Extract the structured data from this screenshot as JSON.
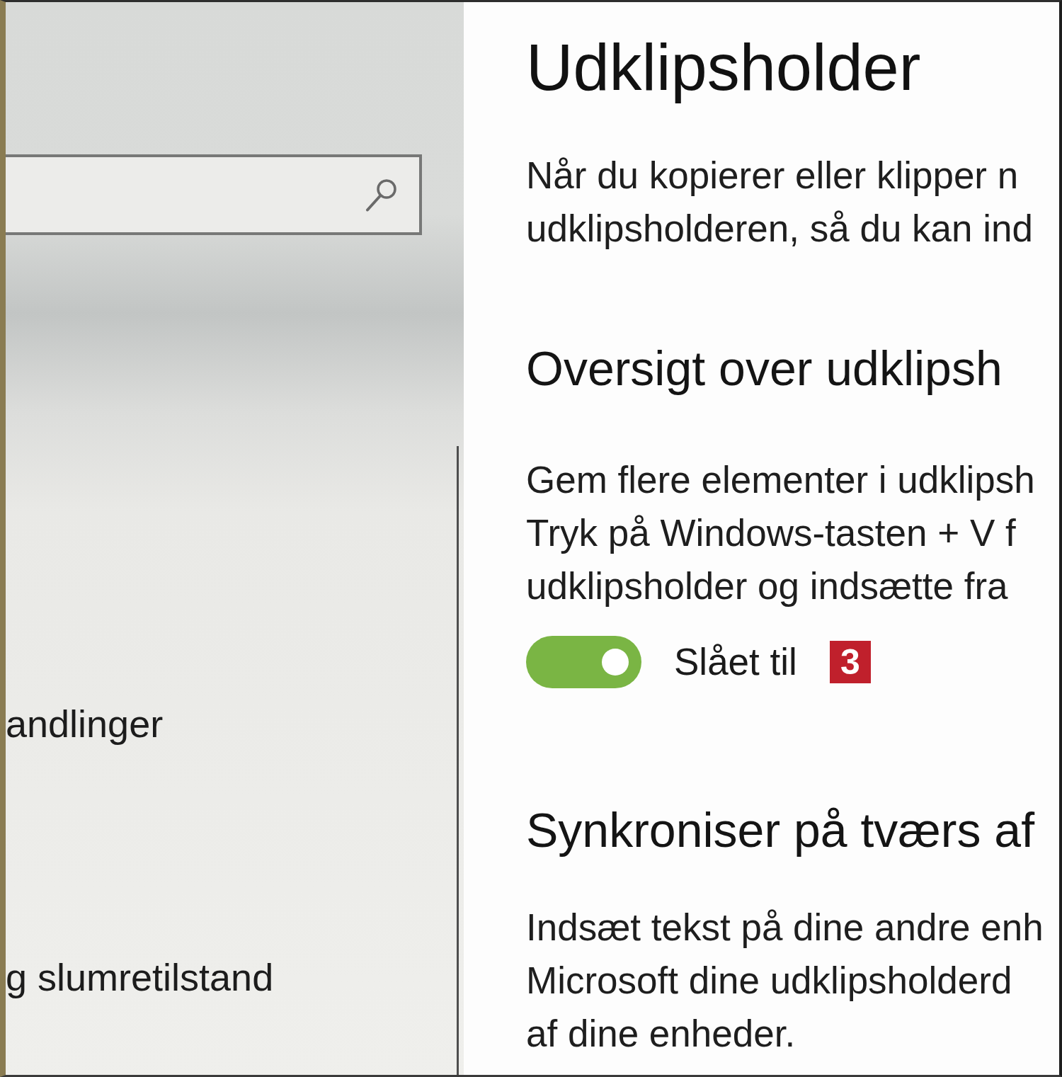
{
  "sidebar": {
    "items": [
      {
        "label": "andlinger",
        "selected": false
      },
      {
        "label": "g slumretilstand",
        "selected": false
      }
    ]
  },
  "content": {
    "title": "Udklipsholder",
    "intro": {
      "lines": [
        "Når du kopierer eller klipper n",
        "udklipsholderen, så du kan ind"
      ]
    },
    "sections": [
      {
        "heading": "Oversigt over udklipsh",
        "description": {
          "lines": [
            "Gem flere elementer i udklipsh",
            "Tryk på Windows-tasten + V f",
            "udklipsholder og indsætte fra"
          ]
        },
        "toggle": {
          "on": true,
          "label": "Slået til",
          "badge": "3"
        }
      },
      {
        "heading": "Synkroniser på tværs af",
        "description": {
          "lines": [
            "Indsæt tekst på dine andre enh",
            "Microsoft dine udklipsholderd",
            "af dine enheder."
          ]
        }
      }
    ]
  }
}
